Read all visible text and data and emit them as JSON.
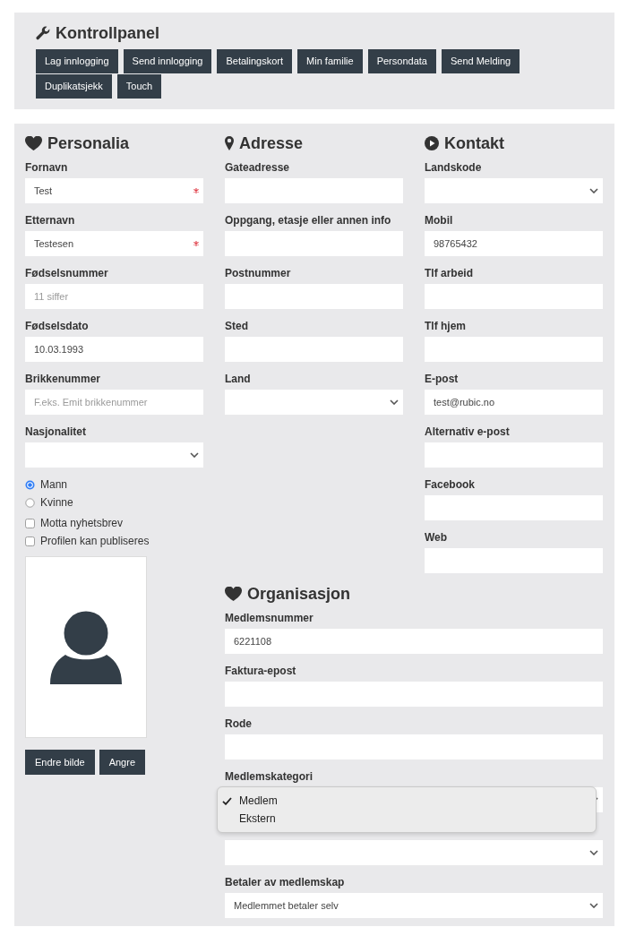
{
  "control_panel": {
    "title": "Kontrollpanel",
    "buttons": [
      "Lag innlogging",
      "Send innlogging",
      "Betalingskort",
      "Min familie",
      "Persondata",
      "Send Melding",
      "Duplikatsjekk",
      "Touch"
    ]
  },
  "personalia": {
    "title": "Personalia",
    "fields": [
      {
        "label": "Fornavn",
        "kind": "text",
        "value": "Test",
        "required": true
      },
      {
        "label": "Etternavn",
        "kind": "text",
        "value": "Testesen",
        "required": true
      },
      {
        "label": "Fødselsnummer",
        "kind": "text",
        "placeholder": "11 siffer",
        "required": false
      },
      {
        "label": "Fødselsdato",
        "kind": "text",
        "value": "10.03.1993",
        "required": false
      },
      {
        "label": "Brikkenummer",
        "kind": "text",
        "placeholder": "F.eks. Emit brikkenummer",
        "required": false
      },
      {
        "label": "Nasjonalitet",
        "kind": "select",
        "required": false,
        "expanded": false
      }
    ],
    "gender": [
      {
        "label": "Mann",
        "selected": true
      },
      {
        "label": "Kvinne",
        "selected": false
      }
    ],
    "checkboxes": [
      {
        "label": "Motta nyhetsbrev",
        "checked": false
      },
      {
        "label": "Profilen kan publiseres",
        "checked": false
      }
    ],
    "photo_buttons": [
      "Endre bilde",
      "Angre"
    ]
  },
  "adresse": {
    "title": "Adresse",
    "fields": [
      {
        "label": "Gateadresse",
        "kind": "text",
        "required": false
      },
      {
        "label": "Oppgang, etasje eller annen info",
        "kind": "text",
        "required": false
      },
      {
        "label": "Postnummer",
        "kind": "text",
        "required": false
      },
      {
        "label": "Sted",
        "kind": "text",
        "required": false
      },
      {
        "label": "Land",
        "kind": "select",
        "required": false,
        "expanded": false
      }
    ]
  },
  "kontakt": {
    "title": "Kontakt",
    "fields": [
      {
        "label": "Landskode",
        "kind": "select",
        "required": false,
        "expanded": false
      },
      {
        "label": "Mobil",
        "kind": "text",
        "value": "98765432",
        "required": false
      },
      {
        "label": "Tlf arbeid",
        "kind": "text",
        "required": false
      },
      {
        "label": "Tlf hjem",
        "kind": "text",
        "required": false
      },
      {
        "label": "E-post",
        "kind": "text",
        "value": "test@rubic.no",
        "required": false
      },
      {
        "label": "Alternativ e-post",
        "kind": "text",
        "required": false
      },
      {
        "label": "Facebook",
        "kind": "text",
        "required": false
      },
      {
        "label": "Web",
        "kind": "text",
        "required": false
      }
    ]
  },
  "organisasjon": {
    "title": "Organisasjon",
    "fields": [
      {
        "label": "Medlemsnummer",
        "kind": "text",
        "value": "6221108",
        "required": false
      },
      {
        "label": "Faktura-epost",
        "kind": "text",
        "required": false
      },
      {
        "label": "Rode",
        "kind": "text",
        "required": false
      },
      {
        "label": "Medlemskategori",
        "kind": "select",
        "required": false,
        "expanded": true,
        "options": [
          {
            "label": "Medlem",
            "selected": true
          },
          {
            "label": "Ekstern",
            "selected": false
          }
        ]
      },
      {
        "kind": "select",
        "required": false,
        "expanded": false
      },
      {
        "label": "Betaler av medlemskap",
        "kind": "select",
        "value": "Medlemmet betaler selv",
        "required": false,
        "expanded": false
      }
    ]
  }
}
